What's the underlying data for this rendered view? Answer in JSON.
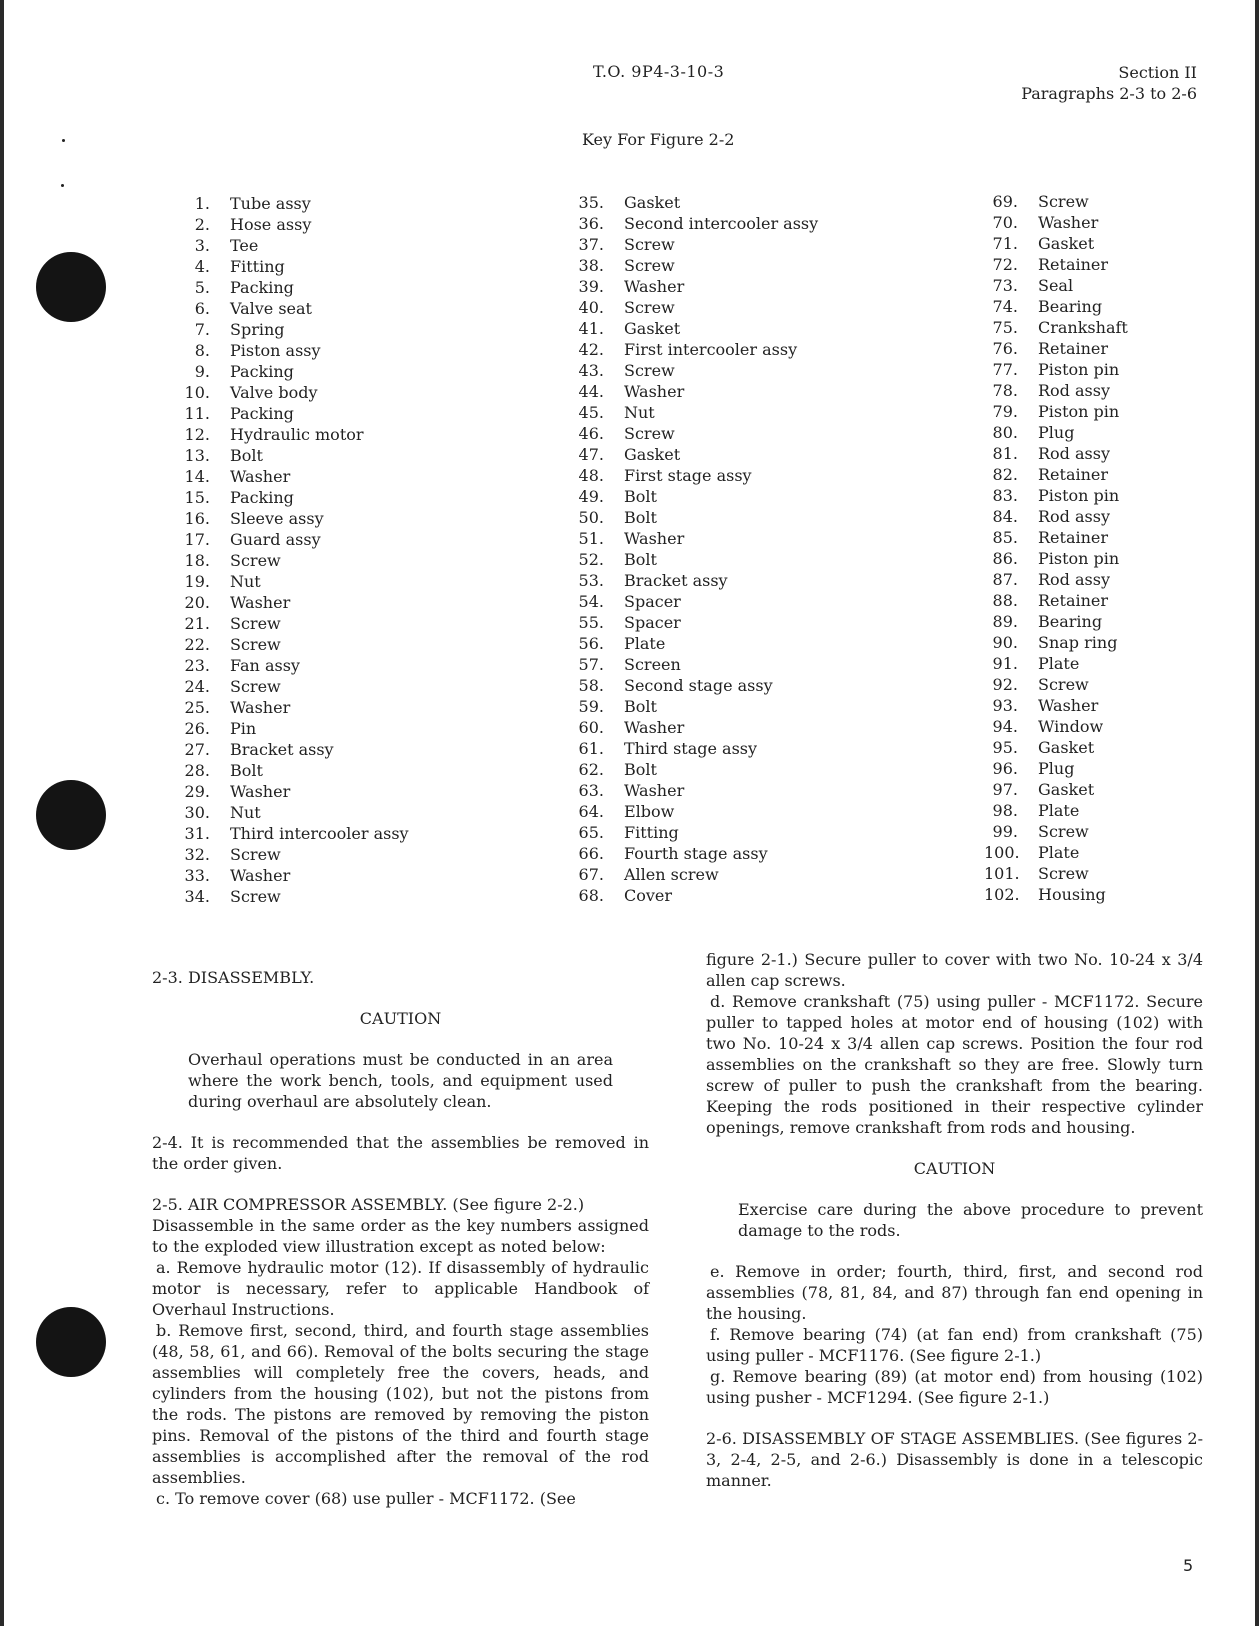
{
  "header": {
    "technical_order": "T.O. 9P4-3-10-3",
    "section": "Section II",
    "paragraphs": "Paragraphs 2-3 to 2-6"
  },
  "key_title": "Key For Figure 2-2",
  "key_columns": [
    [
      {
        "num": "1.",
        "name": "Tube assy"
      },
      {
        "num": "2.",
        "name": "Hose assy"
      },
      {
        "num": "3.",
        "name": "Tee"
      },
      {
        "num": "4.",
        "name": "Fitting"
      },
      {
        "num": "5.",
        "name": "Packing"
      },
      {
        "num": "6.",
        "name": "Valve seat"
      },
      {
        "num": "7.",
        "name": "Spring"
      },
      {
        "num": "8.",
        "name": "Piston assy"
      },
      {
        "num": "9.",
        "name": "Packing"
      },
      {
        "num": "10.",
        "name": "Valve body"
      },
      {
        "num": "11.",
        "name": "Packing"
      },
      {
        "num": "12.",
        "name": "Hydraulic motor"
      },
      {
        "num": "13.",
        "name": "Bolt"
      },
      {
        "num": "14.",
        "name": "Washer"
      },
      {
        "num": "15.",
        "name": "Packing"
      },
      {
        "num": "16.",
        "name": "Sleeve assy"
      },
      {
        "num": "17.",
        "name": "Guard assy"
      },
      {
        "num": "18.",
        "name": "Screw"
      },
      {
        "num": "19.",
        "name": "Nut"
      },
      {
        "num": "20.",
        "name": "Washer"
      },
      {
        "num": "21.",
        "name": "Screw"
      },
      {
        "num": "22.",
        "name": "Screw"
      },
      {
        "num": "23.",
        "name": "Fan assy"
      },
      {
        "num": "24.",
        "name": "Screw"
      },
      {
        "num": "25.",
        "name": "Washer"
      },
      {
        "num": "26.",
        "name": "Pin"
      },
      {
        "num": "27.",
        "name": "Bracket assy"
      },
      {
        "num": "28.",
        "name": "Bolt"
      },
      {
        "num": "29.",
        "name": "Washer"
      },
      {
        "num": "30.",
        "name": "Nut"
      },
      {
        "num": "31.",
        "name": "Third intercooler assy"
      },
      {
        "num": "32.",
        "name": "Screw"
      },
      {
        "num": "33.",
        "name": "Washer"
      },
      {
        "num": "34.",
        "name": "Screw"
      }
    ],
    [
      {
        "num": "35.",
        "name": "Gasket"
      },
      {
        "num": "36.",
        "name": "Second intercooler assy"
      },
      {
        "num": "37.",
        "name": "Screw"
      },
      {
        "num": "38.",
        "name": "Screw"
      },
      {
        "num": "39.",
        "name": "Washer"
      },
      {
        "num": "40.",
        "name": "Screw"
      },
      {
        "num": "41.",
        "name": "Gasket"
      },
      {
        "num": "42.",
        "name": "First intercooler assy"
      },
      {
        "num": "43.",
        "name": "Screw"
      },
      {
        "num": "44.",
        "name": "Washer"
      },
      {
        "num": "45.",
        "name": "Nut"
      },
      {
        "num": "46.",
        "name": "Screw"
      },
      {
        "num": "47.",
        "name": "Gasket"
      },
      {
        "num": "48.",
        "name": "First stage assy"
      },
      {
        "num": "49.",
        "name": "Bolt"
      },
      {
        "num": "50.",
        "name": "Bolt"
      },
      {
        "num": "51.",
        "name": "Washer"
      },
      {
        "num": "52.",
        "name": "Bolt"
      },
      {
        "num": "53.",
        "name": "Bracket assy"
      },
      {
        "num": "54.",
        "name": "Spacer"
      },
      {
        "num": "55.",
        "name": "Spacer"
      },
      {
        "num": "56.",
        "name": "Plate"
      },
      {
        "num": "57.",
        "name": "Screen"
      },
      {
        "num": "58.",
        "name": "Second stage assy"
      },
      {
        "num": "59.",
        "name": "Bolt"
      },
      {
        "num": "60.",
        "name": "Washer"
      },
      {
        "num": "61.",
        "name": "Third stage assy"
      },
      {
        "num": "62.",
        "name": "Bolt"
      },
      {
        "num": "63.",
        "name": "Washer"
      },
      {
        "num": "64.",
        "name": "Elbow"
      },
      {
        "num": "65.",
        "name": "Fitting"
      },
      {
        "num": "66.",
        "name": "Fourth stage assy"
      },
      {
        "num": "67.",
        "name": "Allen screw"
      },
      {
        "num": "68.",
        "name": "Cover"
      }
    ],
    [
      {
        "num": "69.",
        "name": "Screw"
      },
      {
        "num": "70.",
        "name": "Washer"
      },
      {
        "num": "71.",
        "name": "Gasket"
      },
      {
        "num": "72.",
        "name": "Retainer"
      },
      {
        "num": "73.",
        "name": "Seal"
      },
      {
        "num": "74.",
        "name": "Bearing"
      },
      {
        "num": "75.",
        "name": "Crankshaft"
      },
      {
        "num": "76.",
        "name": "Retainer"
      },
      {
        "num": "77.",
        "name": "Piston pin"
      },
      {
        "num": "78.",
        "name": "Rod assy"
      },
      {
        "num": "79.",
        "name": "Piston pin"
      },
      {
        "num": "80.",
        "name": "Plug"
      },
      {
        "num": "81.",
        "name": "Rod assy"
      },
      {
        "num": "82.",
        "name": "Retainer"
      },
      {
        "num": "83.",
        "name": "Piston pin"
      },
      {
        "num": "84.",
        "name": "Rod assy"
      },
      {
        "num": "85.",
        "name": "Retainer"
      },
      {
        "num": "86.",
        "name": "Piston pin"
      },
      {
        "num": "87.",
        "name": "Rod assy"
      },
      {
        "num": "88.",
        "name": "Retainer"
      },
      {
        "num": "89.",
        "name": "Bearing"
      },
      {
        "num": "90.",
        "name": "Snap ring"
      },
      {
        "num": "91.",
        "name": "Plate"
      },
      {
        "num": "92.",
        "name": "Screw"
      },
      {
        "num": "93.",
        "name": "Washer"
      },
      {
        "num": "94.",
        "name": "Window"
      },
      {
        "num": "95.",
        "name": "Gasket"
      },
      {
        "num": "96.",
        "name": "Plug"
      },
      {
        "num": "97.",
        "name": "Gasket"
      },
      {
        "num": "98.",
        "name": "Plate"
      },
      {
        "num": "99.",
        "name": "Screw"
      },
      {
        "num": "100.",
        "name": "Plate"
      },
      {
        "num": "101.",
        "name": "Screw"
      },
      {
        "num": "102.",
        "name": "Housing"
      }
    ]
  ],
  "body": {
    "p2_3_heading": "2-3.  DISASSEMBLY.",
    "caution1_label": "CAUTION",
    "caution1_text": "Overhaul operations must be conducted in an area where the work bench, tools, and equipment used during overhaul are absolutely clean.",
    "p2_4": "2-4.  It is recommended that the assemblies be removed in the order given.",
    "p2_5_heading": "2-5.  AIR COMPRESSOR ASSEMBLY. (See figure 2-2.)",
    "p2_5_intro": "Disassemble in the same order as the key numbers assigned to the exploded view illustration except as noted below:",
    "step_a": "a.  Remove hydraulic motor (12).  If disassembly of hydraulic motor is necessary, refer to applicable Handbook of Overhaul Instructions.",
    "step_b": "b.  Remove first, second, third, and fourth stage assemblies (48, 58, 61, and 66).  Removal of the bolts securing the stage assemblies will completely free the covers, heads, and cylinders from the housing (102), but not the pistons from the rods.  The pistons are removed by removing the piston pins.  Removal of the pistons of the third and fourth stage assemblies is accomplished after the removal of the rod assemblies.",
    "step_c_part1": "c.  To remove cover (68) use puller - MCF1172.  (See",
    "step_c_part2": "figure 2-1.)  Secure puller to cover with two No. 10-24 x 3/4 allen cap screws.",
    "step_d": "d.  Remove crankshaft (75) using puller - MCF1172. Secure puller to tapped holes at motor end of housing (102) with two No. 10-24 x 3/4 allen cap screws.  Position the four rod assemblies on the crankshaft so they are free.  Slowly turn screw of puller to push the crankshaft from the bearing.  Keeping the rods positioned in their respective cylinder openings, remove crankshaft from rods and housing.",
    "caution2_label": "CAUTION",
    "caution2_text": "Exercise care during the above procedure to prevent damage to the rods.",
    "step_e": "e.  Remove in order; fourth, third, first, and second rod assemblies (78, 81, 84, and 87) through fan end opening in the housing.",
    "step_f": "f.  Remove bearing (74) (at fan end) from crankshaft (75) using puller - MCF1176.  (See figure 2-1.)",
    "step_g": "g.  Remove bearing (89) (at motor end) from housing (102) using pusher - MCF1294.  (See figure 2-1.)",
    "p2_6": "2-6.  DISASSEMBLY OF STAGE ASSEMBLIES.  (See figures 2-3, 2-4, 2-5, and 2-6.)  Disassembly is done in a telescopic manner."
  },
  "page_number": "5"
}
